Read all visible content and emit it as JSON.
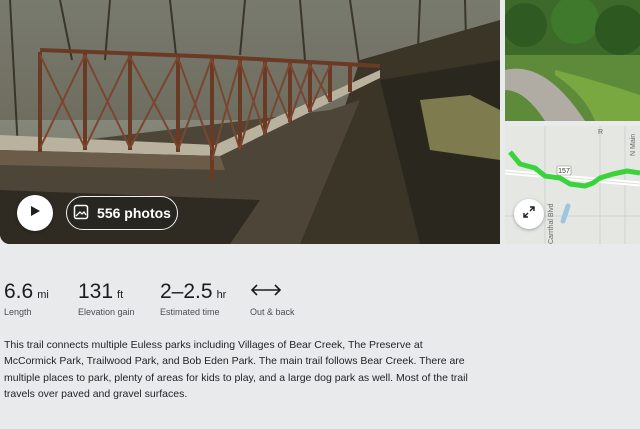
{
  "gallery": {
    "photos_label": "556 photos",
    "play_icon": "play-icon",
    "photos_icon": "image-gallery-icon",
    "expand_icon": "expand-icon",
    "map_labels": {
      "route_number": "157",
      "road_name": "Carrthal Blvd",
      "corner_label_1": "N Main",
      "corner_label_2": "R"
    }
  },
  "stats": [
    {
      "value": "6.6",
      "unit": "mi",
      "label": "Length"
    },
    {
      "value": "131",
      "unit": "ft",
      "label": "Elevation gain"
    },
    {
      "value": "2–2.5",
      "unit": "hr",
      "label": "Estimated time"
    },
    {
      "value": "",
      "unit": "",
      "label": "Out & back",
      "icon": "out-and-back-arrow-icon"
    }
  ],
  "description": "This trail connects multiple Euless parks including Villages of Bear Creek, The Preserve at McCormick Park, Trailwood Park, and Bob Eden Park. The main trail follows Bear Creek.  There are multiple places to park, plenty of areas for kids to play, and a large dog park as well. Most of the trail travels over paved and gravel surfaces.",
  "colors": {
    "route": "#3bd33b",
    "background": "#e9eaec"
  }
}
